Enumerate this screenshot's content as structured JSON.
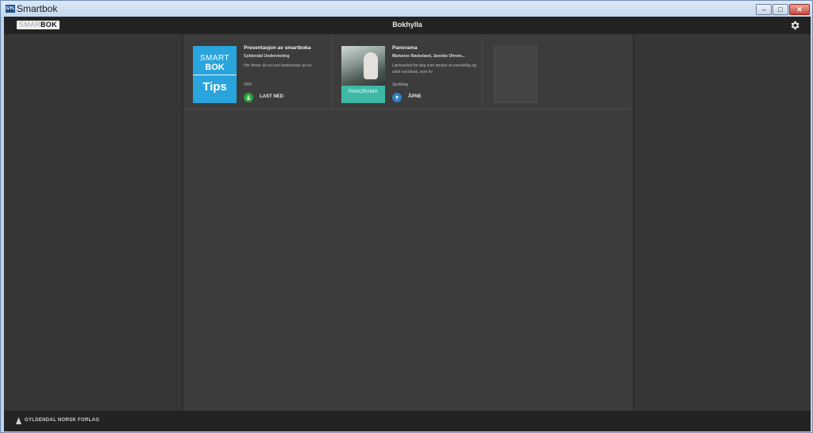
{
  "window": {
    "title": "Smartbok",
    "icon_text": "GYL"
  },
  "header": {
    "logo_part1": "SMART",
    "logo_part2": "BOK",
    "title": "Bokhylla",
    "settings_icon": "gear-icon"
  },
  "books": [
    {
      "cover": {
        "line1": "SMART",
        "line2": "BOK",
        "line3": "Tips"
      },
      "title": "Presentasjon av smartboka",
      "author": "Gyldendal Undervisning",
      "description": "Her finner du en kort beskrivelse av en",
      "subject": "GNF",
      "action_label": "LAST NED",
      "action_icon": "download-icon",
      "action_color": "#2ea043"
    },
    {
      "cover": {
        "band_text": "PANORAMA"
      },
      "title": "Panorama",
      "author": "Marianne Røskeland, Jannike Ohrem...",
      "description": "Læreverket for deg som ønsker et oversiktlig og solid norskbok, som ko",
      "subject": "Språkfag",
      "action_label": "ÅPNE",
      "action_icon": "open-arrow-icon",
      "action_color": "#2f7fc4"
    }
  ],
  "footer": {
    "publisher": "GYLDENDAL NORSK FORLAG"
  }
}
